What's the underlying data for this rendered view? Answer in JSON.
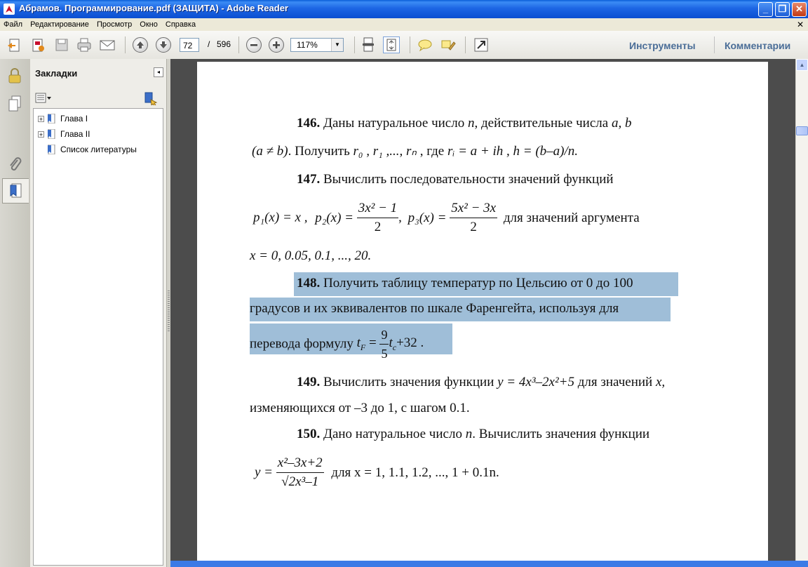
{
  "window": {
    "title": "Абрамов. Программирование.pdf (ЗАЩИТА) - Adobe Reader",
    "controls": {
      "minimize": "_",
      "maximize": "❐",
      "close": "✕"
    }
  },
  "menu": {
    "items": [
      "Файл",
      "Редактирование",
      "Просмотр",
      "Окно",
      "Справка"
    ],
    "close_glyph": "✕"
  },
  "toolbar": {
    "page_current": "72",
    "page_separator": "/",
    "page_total": "596",
    "zoom": "117%",
    "tools_label": "Инструменты",
    "comments_label": "Комментарии",
    "icons": [
      "create-pdf-icon",
      "export-pdf-icon",
      "save-icon",
      "print-icon",
      "email-icon",
      "prev-page-icon",
      "next-page-icon",
      "zoom-out-icon",
      "zoom-in-icon",
      "scroll-mode-icon",
      "fit-page-icon",
      "comment-icon",
      "highlight-icon",
      "fullscreen-icon"
    ]
  },
  "bookmarks": {
    "title": "Закладки",
    "items": [
      {
        "label": "Глава I",
        "expandable": true
      },
      {
        "label": "Глава II",
        "expandable": true
      },
      {
        "label": "Список литературы",
        "expandable": false
      }
    ]
  },
  "document": {
    "p146": {
      "num": "146.",
      "l1_text": " Даны натуральное число ",
      "l1_n": "n",
      "l1_mid": ", действительные числа ",
      "l1_ab": "a, b",
      "l2_cond": "(a ≠ b)",
      "l2_text": ". Получить ",
      "l2_r": "r",
      "l2_seq": "₀ , r₁ ,..., rₙ",
      "l2_where": " , где ",
      "l2_formula": "rᵢ = a + ih",
      "l2_h": " , h = (b–a)/n."
    },
    "p147": {
      "num": "147.",
      "l1_text": " Вычислить последовательности значений функций",
      "p1": "p₁(x) = x ,",
      "p2_lhs": "p₂(x) =",
      "p2_num": "3x² − 1",
      "p2_den": "2",
      "p3_lhs": "p₃(x) =",
      "p3_num": "5x² − 3x",
      "p3_den": "2",
      "tail": "для значений аргумента",
      "l3": "x = 0, 0.05, 0.1, ..., 20."
    },
    "p148": {
      "num": "148.",
      "l1": " Получить таблицу температур по Цельсию от 0 до 100",
      "l2": "градусов и их эквивалентов по шкале Фаренгейта, используя для",
      "l3_text": "перевода формулу ",
      "f_lhs": "t",
      "f_lhs_sub": "F",
      "f_eq": " = ",
      "f_num": "9",
      "f_den": "5",
      "f_rhs": "t",
      "f_rhs_sub": "c",
      "f_tail": "+32 ."
    },
    "p149": {
      "num": "149.",
      "l1_text": " Вычислить значения функции ",
      "l1_formula": "y = 4x³–2x²+5",
      "l1_tail": " для значений ",
      "l1_x": "x,",
      "l2": "изменяющихся от –3 до 1, с шагом 0.1."
    },
    "p150": {
      "num": "150.",
      "l1_text": " Дано натуральное число ",
      "l1_n": "n",
      "l1_tail": ". Вычислить значения функции",
      "y_lhs": "y =",
      "y_num": "x²–3x+2",
      "y_den": "√2x³–1",
      "tail": "для x = 1, 1.1, 1.2, ..., 1 + 0.1n."
    }
  }
}
